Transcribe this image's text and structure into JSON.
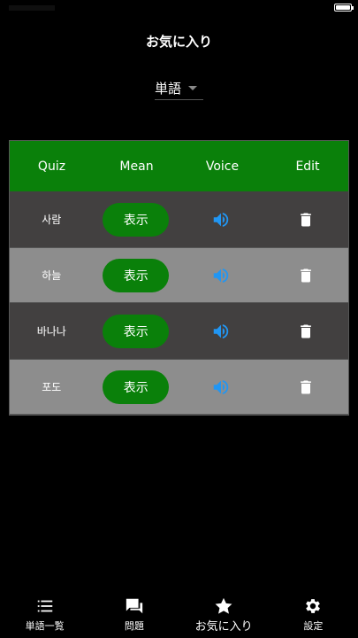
{
  "status_bar": {
    "battery_icon": "battery-icon"
  },
  "header": {
    "title": "お気に入り"
  },
  "filter": {
    "selected": "単語"
  },
  "table": {
    "columns": [
      "Quiz",
      "Mean",
      "Voice",
      "Edit"
    ],
    "show_label": "表示",
    "rows": [
      {
        "quiz": "사람",
        "shade": "dark"
      },
      {
        "quiz": "하늘",
        "shade": "light"
      },
      {
        "quiz": "바나나",
        "shade": "dark"
      },
      {
        "quiz": "포도",
        "shade": "light"
      }
    ]
  },
  "colors": {
    "accent_green": "#0a800a",
    "voice_blue": "#2196f3",
    "row_dark": "#424040",
    "row_light": "#8d8d8d"
  },
  "tabbar": {
    "items": [
      {
        "label": "単語一覧",
        "icon": "list-icon"
      },
      {
        "label": "問題",
        "icon": "chat-icon"
      },
      {
        "label": "お気に入り",
        "icon": "star-icon"
      },
      {
        "label": "設定",
        "icon": "gear-icon"
      }
    ],
    "active_index": 2
  }
}
